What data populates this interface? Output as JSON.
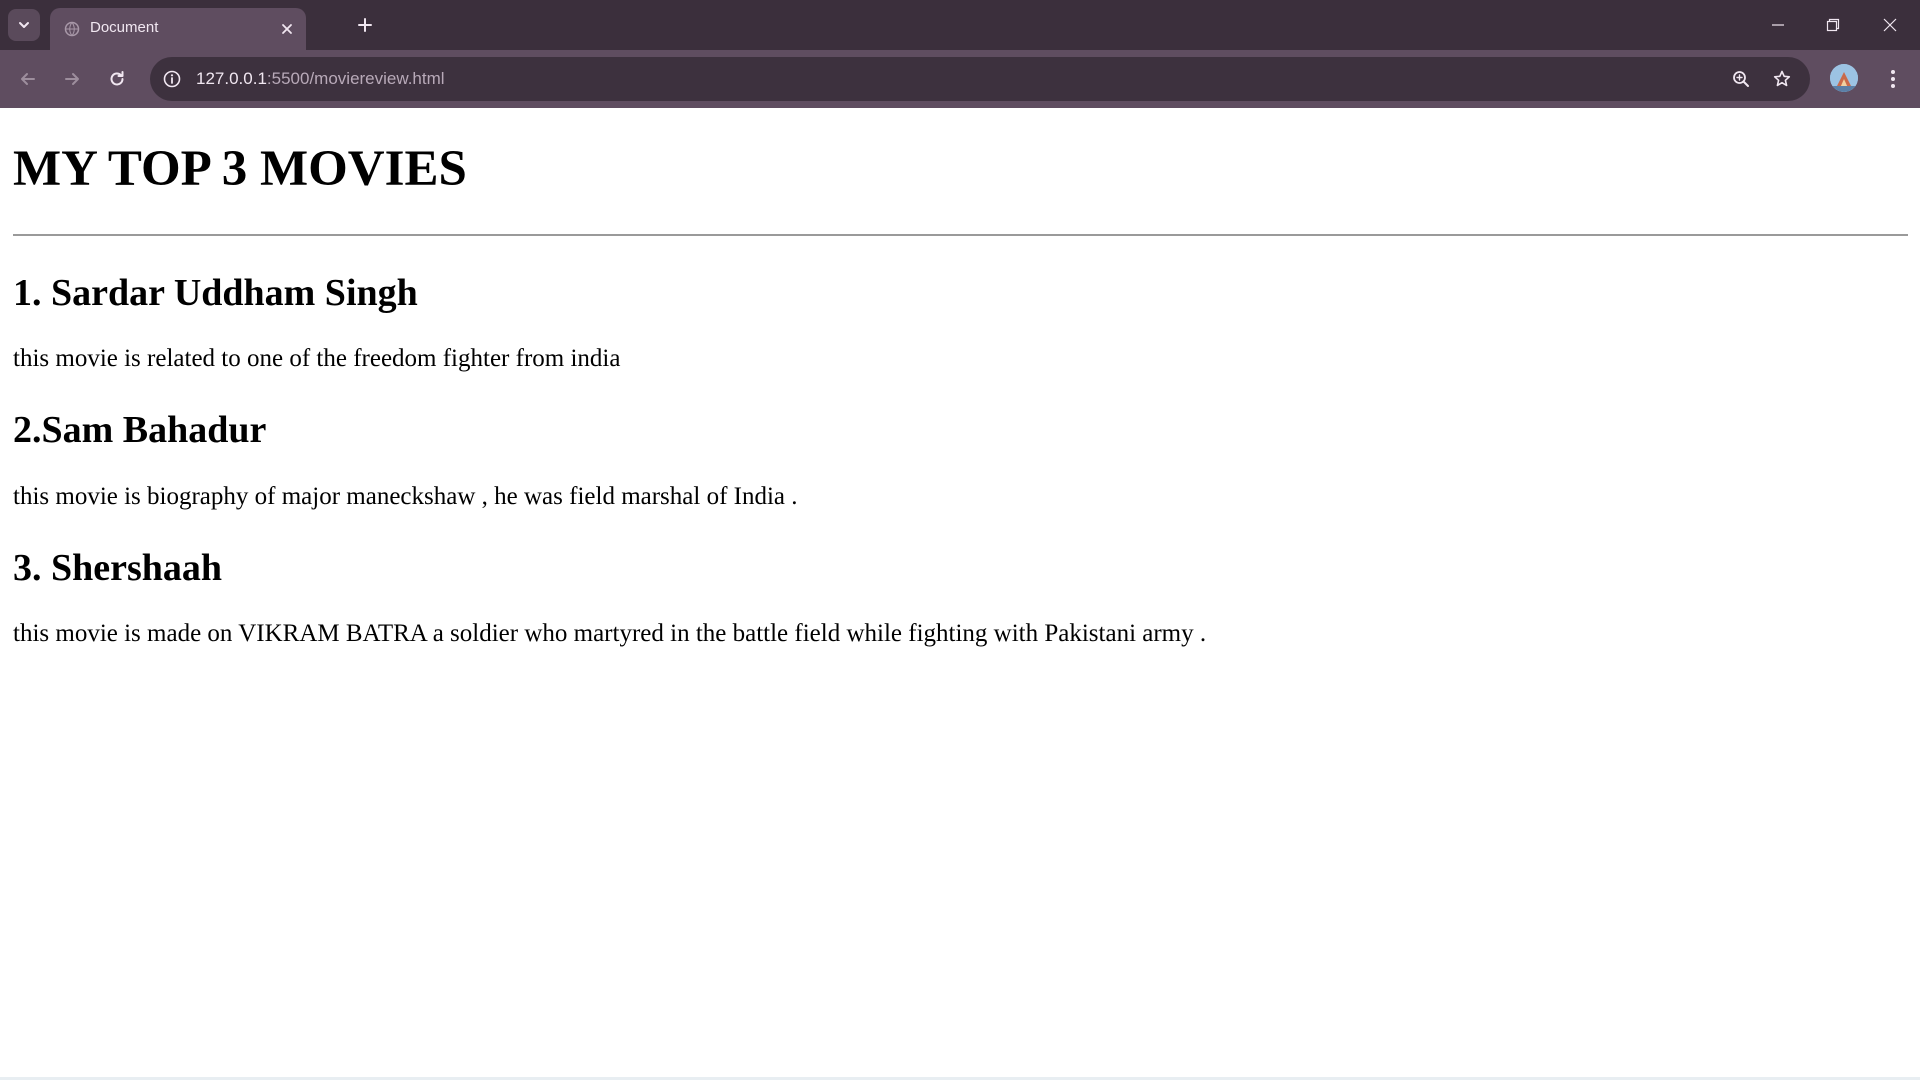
{
  "browser": {
    "tab_title": "Document",
    "url_host": "127.0.0.1",
    "url_rest": ":5500/moviereview.html"
  },
  "page": {
    "title": "MY TOP 3 MOVIES",
    "movies": [
      {
        "heading": "1. Sardar Uddham Singh",
        "description": "this movie is related to one of the freedom fighter from india"
      },
      {
        "heading": "2.Sam Bahadur",
        "description": "this movie is biography of major maneckshaw , he was field marshal of India ."
      },
      {
        "heading": "3. Shershaah",
        "description": "this movie is made on VIKRAM BATRA a soldier who martyred in the battle field while fighting with Pakistani army ."
      }
    ]
  },
  "icons": {
    "tab_search": "chevron-down-icon",
    "favicon": "globe-icon",
    "tab_close": "close-icon",
    "new_tab": "plus-icon",
    "minimize": "minimize-icon",
    "restore": "restore-icon",
    "close_window": "close-icon",
    "back": "arrow-left-icon",
    "forward": "arrow-right-icon",
    "reload": "reload-icon",
    "site_info": "info-icon",
    "zoom": "zoom-icon",
    "bookmark": "star-icon",
    "profile": "avatar-icon",
    "menu": "kebab-menu-icon"
  },
  "colors": {
    "tabstrip": "#3b2f3c",
    "toolbar": "#5f4d60",
    "omnibox": "#3d313e",
    "page_background": "#ffffff"
  }
}
